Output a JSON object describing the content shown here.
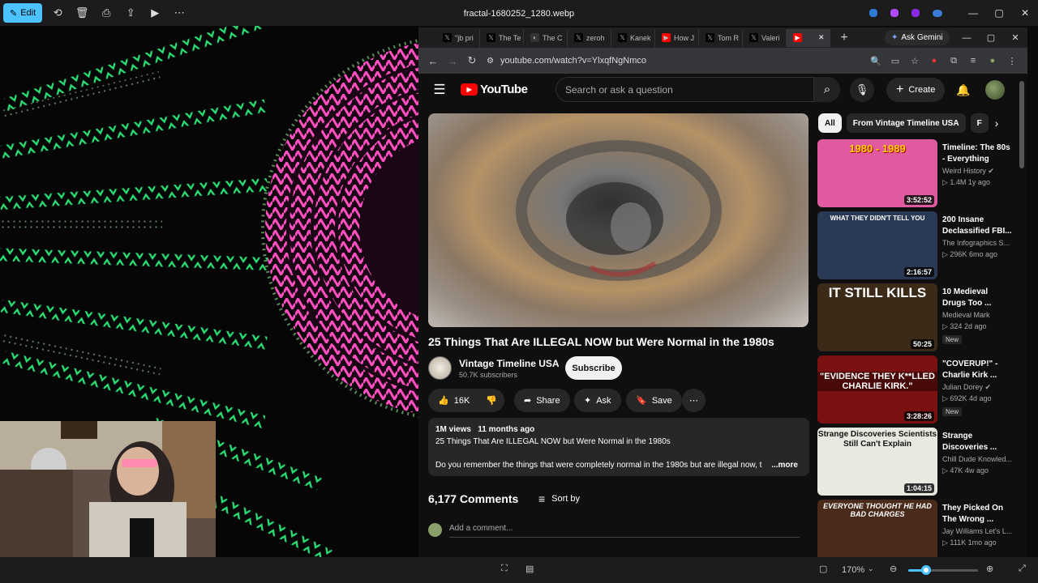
{
  "photos": {
    "edit_label": "Edit",
    "filename": "fractal-1680252_1280.webp",
    "zoom": "170%"
  },
  "tabs": [
    {
      "label": "\"jb pri",
      "favicon": "x-icon"
    },
    {
      "label": "The Te",
      "favicon": "x-icon"
    },
    {
      "label": "The C",
      "favicon": "grok-icon"
    },
    {
      "label": "zeroh",
      "favicon": "x-icon"
    },
    {
      "label": "Kanek",
      "favicon": "x-icon"
    },
    {
      "label": "How J",
      "favicon": "youtube-icon"
    },
    {
      "label": "Tom R",
      "favicon": "x-icon"
    },
    {
      "label": "Valeri",
      "favicon": "x-icon"
    },
    {
      "label": "",
      "favicon": "youtube-icon",
      "active": true
    }
  ],
  "browser": {
    "ask_gemini": "Ask Gemini",
    "url": "youtube.com/watch?v=YlxqfNgNmco"
  },
  "youtube": {
    "logo_text": "YouTube",
    "search_placeholder": "Search or ask a question",
    "create_label": "Create"
  },
  "video": {
    "title": "25 Things That Are ILLEGAL NOW but Were Normal in the 1980s",
    "channel": "Vintage Timeline USA",
    "subscribers": "50.7K subscribers",
    "subscribe_label": "Subscribe",
    "likes": "16K",
    "share_label": "Share",
    "ask_label": "Ask",
    "save_label": "Save",
    "views": "1M views",
    "age": "11 months ago",
    "desc_line1": "25 Things That Are ILLEGAL NOW but Were Normal in the 1980s",
    "desc_line2": "Do you remember the things that were completely normal in the 1980s but are illegal now, t",
    "more_label": "...more",
    "comments_count": "6,177 Comments",
    "sort_label": "Sort by",
    "add_comment": "Add a comment..."
  },
  "chips": [
    "All",
    "From Vintage Timeline USA",
    "F"
  ],
  "recommendations": [
    {
      "title": "Timeline: The 80s - Everything Tha...",
      "channel": "Weird History",
      "verified": true,
      "meta": "▷ 1.4M   1y ago",
      "duration": "3:52:52",
      "thumb_caption": "1980 - 1989",
      "thumb_bg": "#e05aa0",
      "badge": ""
    },
    {
      "title": "200 Insane Declassified FBI...",
      "channel": "The Infographics S...",
      "verified": false,
      "meta": "▷ 296K   6mo ago",
      "duration": "2:16:57",
      "thumb_caption": "WHAT THEY DIDN'T TELL YOU",
      "thumb_bg": "#2a3a55",
      "badge": ""
    },
    {
      "title": "10 Medieval Drugs Too ...",
      "channel": "Medieval Mark",
      "verified": false,
      "meta": "▷ 324   2d ago",
      "duration": "50:25",
      "thumb_caption": "IT STILL KILLS",
      "thumb_bg": "#3b2a18",
      "badge": "New"
    },
    {
      "title": "\"COVERUP!\" - Charlie Kirk ...",
      "channel": "Julian Dorey",
      "verified": true,
      "meta": "▷ 692K   4d ago",
      "duration": "3:28:26",
      "thumb_caption": "\"EVIDENCE THEY K**LLED CHARLIE KIRK.\"",
      "thumb_bg": "#7a1010",
      "badge": "New"
    },
    {
      "title": "Strange Discoveries ...",
      "channel": "Chill Dude Knowled...",
      "verified": false,
      "meta": "▷ 47K   4w ago",
      "duration": "1:04:15",
      "thumb_caption": "Strange Discoveries Scientists Still Can't Explain",
      "thumb_bg": "#e9e9e2",
      "badge": ""
    },
    {
      "title": "They Picked On The Wrong ...",
      "channel": "Jay Williams Let's L...",
      "verified": false,
      "meta": "▷ 111K   1mo ago",
      "duration": "",
      "thumb_caption": "EVERYONE THOUGHT HE HAD BAD CHARGES",
      "thumb_bg": "#4a2a1a",
      "badge": ""
    }
  ]
}
